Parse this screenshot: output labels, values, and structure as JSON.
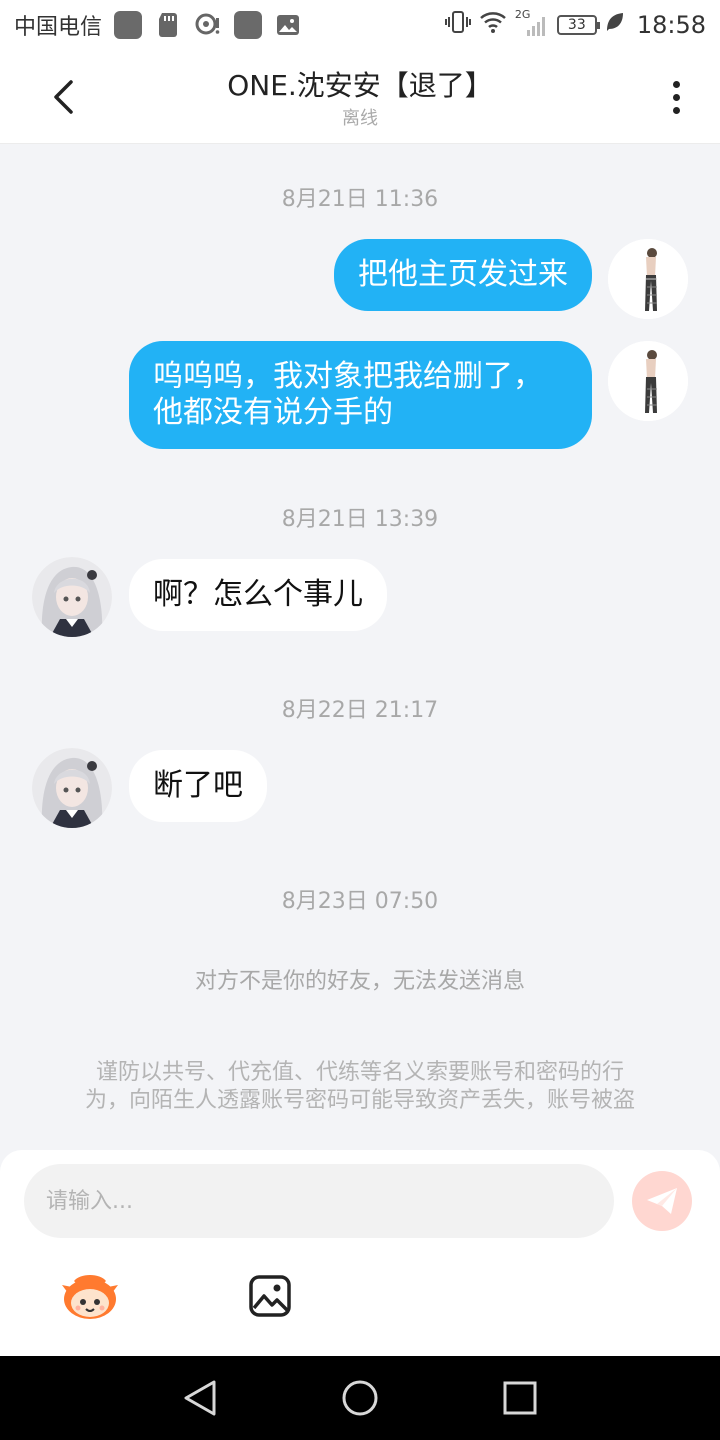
{
  "status_bar": {
    "carrier": "中国电信",
    "network": "2G",
    "battery": "33",
    "time": "18:58"
  },
  "header": {
    "title": "ONE.沈安安【退了】",
    "subtitle": "离线"
  },
  "messages": {
    "ts1": "8月21日 11:36",
    "m1": "把他主页发过来",
    "m2_line1": "呜呜呜，我对象把我给删了，",
    "m2_line2": "他都没有说分手的",
    "ts2": "8月21日 13:39",
    "m3": "啊？怎么个事儿",
    "ts3": "8月22日 21:17",
    "m4": "断了吧",
    "ts4": "8月23日 07:50"
  },
  "notice": "对方不是你的好友，无法发送消息",
  "warning": {
    "line1": "谨防以共号、代充值、代练等名义索要账号和密码的行",
    "line2": "为，向陌生人透露账号密码可能导致资产丢失，账号被盗"
  },
  "input": {
    "placeholder": "请输入..."
  },
  "colors": {
    "outgoing_bubble": "#22b2f5",
    "incoming_bubble": "#ffffff",
    "chat_background": "#f3f4f7",
    "send_button": "#ffd7d1"
  },
  "icons": {
    "back": "back-arrow-icon",
    "more": "more-vertical-icon",
    "send": "send-plane-icon",
    "emoji": "emoji-mascot-icon",
    "image": "image-icon"
  }
}
